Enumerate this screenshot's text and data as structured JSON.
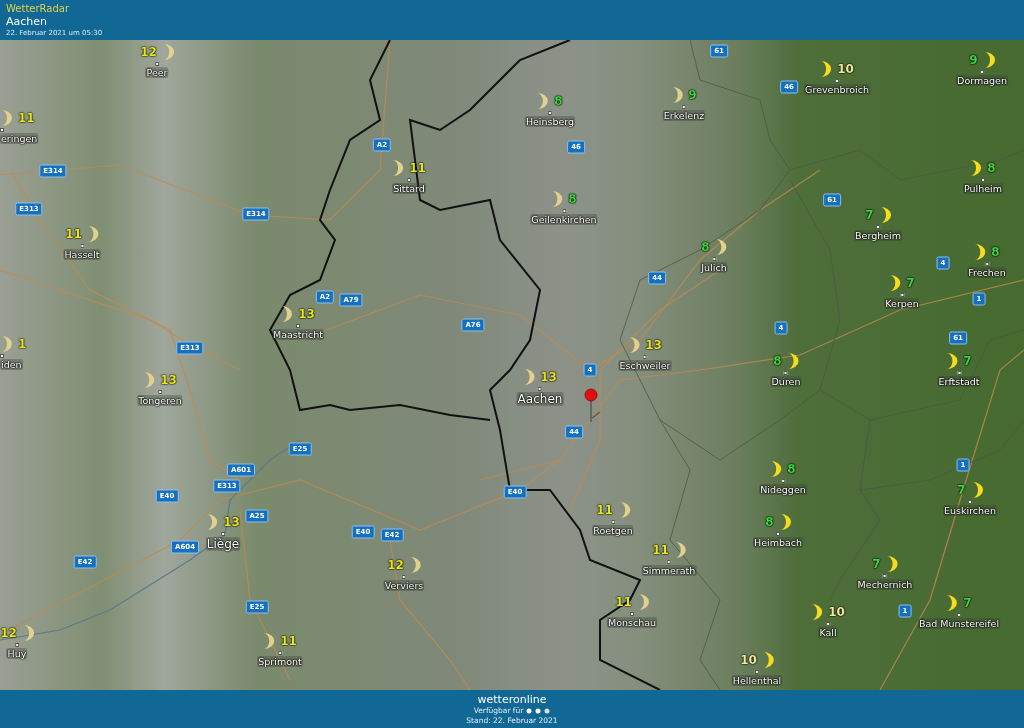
{
  "header": {
    "app": "WetterRadar",
    "location": "Aachen",
    "timestamp": "22. Februar 2021 um 05:30"
  },
  "cities": [
    {
      "name": "Peer",
      "temp": "12",
      "color": "#e6e61e"
    },
    {
      "name": "eringen",
      "temp": "11",
      "color": "#e6e61e"
    },
    {
      "name": "Hasselt",
      "temp": "11",
      "color": "#e6e61e"
    },
    {
      "name": "iden",
      "temp": "1",
      "color": "#e6e61e"
    },
    {
      "name": "Tongeren",
      "temp": "13",
      "color": "#e6e61e"
    },
    {
      "name": "Sittard",
      "temp": "11",
      "color": "#e6e61e"
    },
    {
      "name": "Maastricht",
      "temp": "13",
      "color": "#e6e61e"
    },
    {
      "name": "Heinsberg",
      "temp": "8",
      "color": "#3fd13f"
    },
    {
      "name": "Erkelenz",
      "temp": "9",
      "color": "#3fd13f"
    },
    {
      "name": "Grevenbroich",
      "temp": "10",
      "color": "#eaea9a"
    },
    {
      "name": "Dormagen",
      "temp": "9",
      "color": "#3fd13f"
    },
    {
      "name": "Geilenkirchen",
      "temp": "8",
      "color": "#3fd13f"
    },
    {
      "name": "Pulheim",
      "temp": "8",
      "color": "#3fd13f"
    },
    {
      "name": "Bergheim",
      "temp": "7",
      "color": "#3fd13f"
    },
    {
      "name": "Julich",
      "temp": "8",
      "color": "#3fd13f"
    },
    {
      "name": "Frechen",
      "temp": "8",
      "color": "#3fd13f"
    },
    {
      "name": "Kerpen",
      "temp": "7",
      "color": "#3fd13f"
    },
    {
      "name": "Eschweiler",
      "temp": "13",
      "color": "#e6e61e"
    },
    {
      "name": "Duren",
      "temp": "8",
      "color": "#3fd13f"
    },
    {
      "name": "Erftstadt",
      "temp": "7",
      "color": "#3fd13f"
    },
    {
      "name": "Aachen",
      "temp": "13",
      "color": "#e6e61e"
    },
    {
      "name": "Liège",
      "temp": "13",
      "color": "#e6e61e"
    },
    {
      "name": "Verviers",
      "temp": "12",
      "color": "#e6e61e"
    },
    {
      "name": "Huy",
      "temp": "12",
      "color": "#e6e61e"
    },
    {
      "name": "Sprimont",
      "temp": "11",
      "color": "#e6e61e"
    },
    {
      "name": "Roetgen",
      "temp": "11",
      "color": "#e6e61e"
    },
    {
      "name": "Simmerath",
      "temp": "11",
      "color": "#e6e61e"
    },
    {
      "name": "Monschau",
      "temp": "11",
      "color": "#e6e61e"
    },
    {
      "name": "Nideggen",
      "temp": "8",
      "color": "#3fd13f"
    },
    {
      "name": "Heimbach",
      "temp": "8",
      "color": "#3fd13f"
    },
    {
      "name": "Euskirchen",
      "temp": "7",
      "color": "#3fd13f"
    },
    {
      "name": "Mechernich",
      "temp": "7",
      "color": "#3fd13f"
    },
    {
      "name": "Bad Munstereifel",
      "temp": "7",
      "color": "#3fd13f"
    },
    {
      "name": "Kall",
      "temp": "10",
      "color": "#eaea9a"
    },
    {
      "name": "Hellenthal",
      "temp": "10",
      "color": "#eaea9a"
    }
  ],
  "roads": [
    "61",
    "46",
    "A2",
    "46",
    "E314",
    "E313",
    "E314",
    "61",
    "44",
    "4",
    "A2",
    "A79",
    "1",
    "A76",
    "4",
    "E313",
    "61",
    "4",
    "44",
    "E25",
    "A601",
    "E313",
    "E40",
    "E40",
    "A25",
    "1",
    "E40",
    "E42",
    "A604",
    "E42",
    "E25",
    "1"
  ],
  "footer": {
    "brand": "wetteronline",
    "available": "Verfügbar für",
    "stand": "Stand: 22. Februar 2021"
  }
}
